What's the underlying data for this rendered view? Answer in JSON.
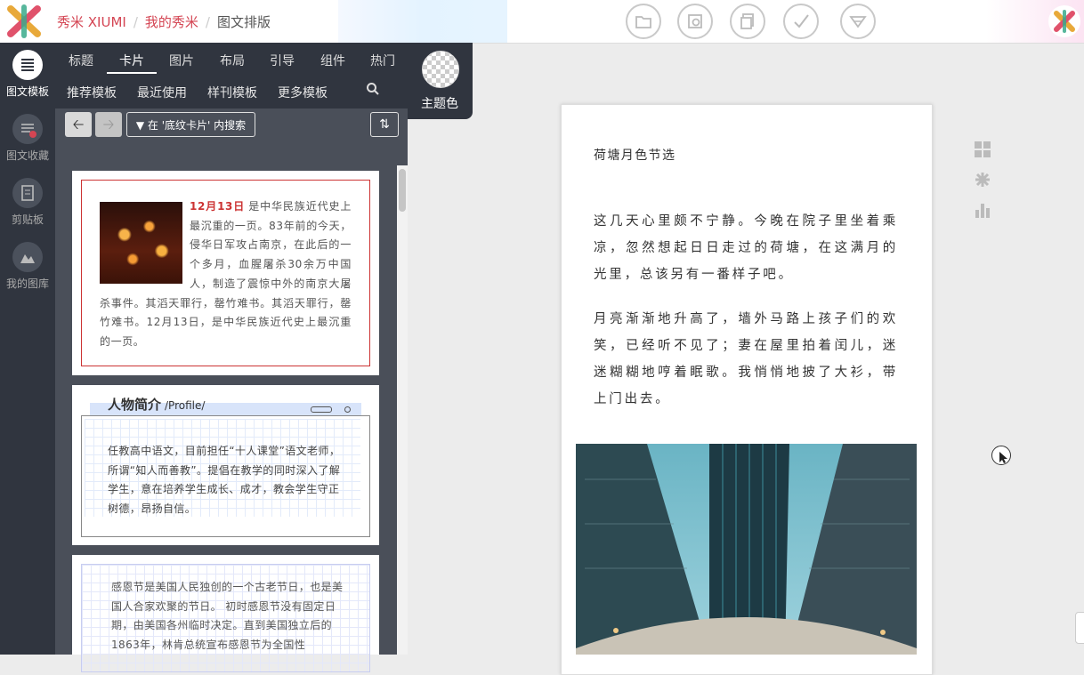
{
  "app": {
    "breadcrumbs": [
      "秀米 XIUMI",
      "我的秀米",
      "图文排版"
    ]
  },
  "toolbar": {
    "icons": [
      "folder-icon",
      "preview-icon",
      "copy-icon",
      "check-icon",
      "dropdown-icon"
    ]
  },
  "sidebar": {
    "items": [
      {
        "label": "图文模板",
        "icon": "template-icon",
        "active": true
      },
      {
        "label": "图文收藏",
        "icon": "favorites-icon",
        "active": false
      },
      {
        "label": "剪贴板",
        "icon": "clipboard-icon",
        "active": false
      },
      {
        "label": "我的图库",
        "icon": "gallery-icon",
        "active": false
      }
    ]
  },
  "panel": {
    "tabs": [
      "标题",
      "卡片",
      "图片",
      "布局",
      "引导",
      "组件",
      "热门"
    ],
    "active_tab": "卡片",
    "subtabs": [
      "推荐模板",
      "最近使用",
      "样刊模板",
      "更多模板"
    ],
    "theme_label": "主题色",
    "filter_label": "在 '底纹卡片' 内搜索",
    "cards": [
      {
        "date": "12月13日",
        "text": "是中华民族近代史上最沉重的一页。83年前的今天，侵华日军攻占南京，在此后的一个多月，血腥屠杀30余万中国人，制造了震惊中外的南京大屠杀事件。其滔天罪行，罄竹难书。其滔天罪行，罄竹难书。12月13日，是中华民族近代史上最沉重的一页。"
      },
      {
        "title": "人物简介",
        "subtitle": "/Profile/",
        "text": "任教高中语文，目前担任“十人课堂”语文老师，所谓“知人而善教”。提倡在教学的同时深入了解学生，意在培养学生成长、成才，教会学生守正树德，昂扬自信。"
      },
      {
        "text": "感恩节是美国人民独创的一个古老节日，也是美国人合家欢聚的节日。 初时感恩节没有固定日期，由美国各州临时决定。直到美国独立后的1863年，林肯总统宣布感恩节为全国性"
      }
    ]
  },
  "document": {
    "title": "荷塘月色节选",
    "paragraphs": [
      "这几天心里颇不宁静。今晚在院子里坐着乘凉，忽然想起日日走过的荷塘，在这满月的光里，总该另有一番样子吧。",
      "月亮渐渐地升高了，墙外马路上孩子们的欢笑，已经听不见了；妻在屋里拍着闰儿，迷迷糊糊地哼着眠歌。我悄悄地披了大衫，带上门出去。"
    ]
  },
  "colors": {
    "accent": "#d44553",
    "sidebar": "#30353f",
    "panel": "#4a4f59"
  }
}
